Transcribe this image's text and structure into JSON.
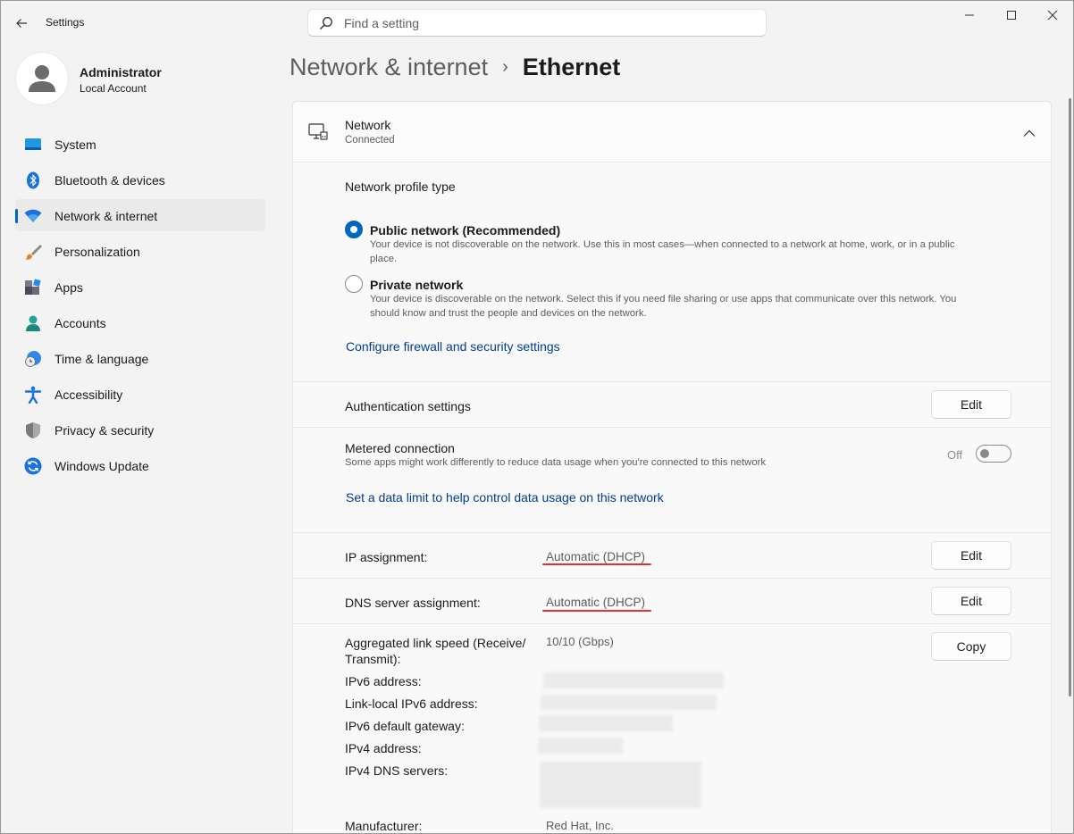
{
  "titlebar": {
    "app_title": "Settings",
    "search_placeholder": "Find a setting"
  },
  "profile": {
    "name": "Administrator",
    "account_type": "Local Account"
  },
  "sidebar": {
    "items": [
      {
        "label": "System",
        "icon": "system-icon",
        "active": false
      },
      {
        "label": "Bluetooth & devices",
        "icon": "bluetooth-icon",
        "active": false
      },
      {
        "label": "Network & internet",
        "icon": "wifi-icon",
        "active": true
      },
      {
        "label": "Personalization",
        "icon": "brush-icon",
        "active": false
      },
      {
        "label": "Apps",
        "icon": "apps-icon",
        "active": false
      },
      {
        "label": "Accounts",
        "icon": "person-icon",
        "active": false
      },
      {
        "label": "Time & language",
        "icon": "globe-clock-icon",
        "active": false
      },
      {
        "label": "Accessibility",
        "icon": "accessibility-icon",
        "active": false
      },
      {
        "label": "Privacy & security",
        "icon": "shield-icon",
        "active": false
      },
      {
        "label": "Windows Update",
        "icon": "update-icon",
        "active": false
      }
    ]
  },
  "breadcrumb": {
    "parent": "Network & internet",
    "separator": "›",
    "current": "Ethernet"
  },
  "network": {
    "title": "Network",
    "status": "Connected"
  },
  "profile_type": {
    "heading": "Network profile type",
    "options": [
      {
        "label": "Public network (Recommended)",
        "desc_line1": "Your device is not discoverable on the network. Use this in most cases—when connected to a network at home, work, or in a public",
        "desc_line2": "place.",
        "selected": true
      },
      {
        "label": "Private network",
        "desc_line1": "Your device is discoverable on the network. Select this if you need file sharing or use apps that communicate over this network. You",
        "desc_line2": "should know and trust the people and devices on the network.",
        "selected": false
      }
    ],
    "firewall_link": "Configure firewall and security settings"
  },
  "auth": {
    "label": "Authentication settings",
    "button": "Edit"
  },
  "metered": {
    "label": "Metered connection",
    "desc": "Some apps might work differently to reduce data usage when you're connected to this network",
    "toggle_state": "Off",
    "data_limit_link": "Set a data limit to help control data usage on this network"
  },
  "ip": {
    "label": "IP assignment:",
    "value": "Automatic (DHCP)",
    "button": "Edit"
  },
  "dns": {
    "label": "DNS server assignment:",
    "value": "Automatic (DHCP)",
    "button": "Edit"
  },
  "properties": {
    "copy_button": "Copy",
    "link_speed_label_1": "Aggregated link speed (Receive/",
    "link_speed_label_2": "Transmit):",
    "link_speed_value": "10/10 (Gbps)",
    "ipv6_label": "IPv6 address:",
    "link_local_label": "Link-local IPv6 address:",
    "ipv6_gateway_label": "IPv6 default gateway:",
    "ipv4_label": "IPv4 address:",
    "ipv4_dns_label": "IPv4 DNS servers:",
    "manufacturer_label": "Manufacturer:",
    "manufacturer_value": "Red Hat, Inc."
  },
  "colors": {
    "accent": "#0067c0",
    "link": "#003e92",
    "annotation": "#e23232"
  }
}
